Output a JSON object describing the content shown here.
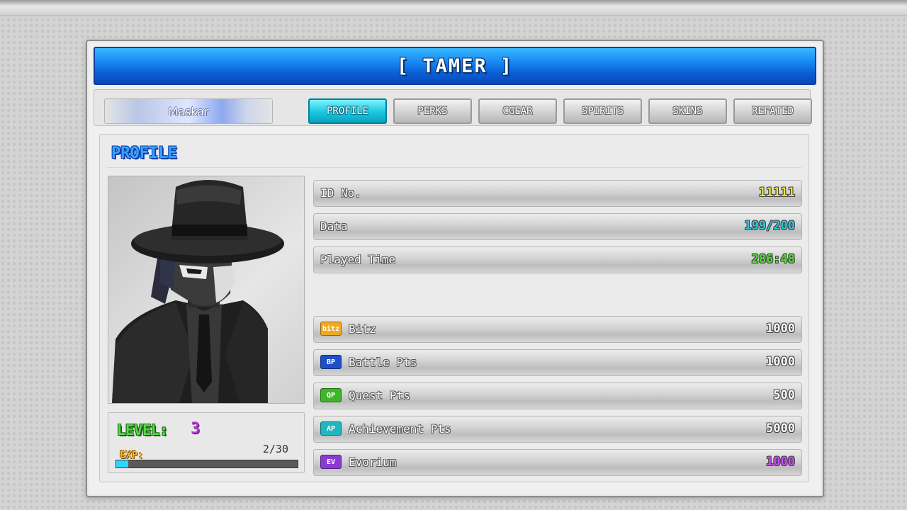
{
  "window": {
    "title": "[ TAMER ]"
  },
  "player": {
    "name": "Maskar"
  },
  "tabs": [
    {
      "label": "PROFILE",
      "active": true
    },
    {
      "label": "PERKS",
      "active": false
    },
    {
      "label": "CGEAR",
      "active": false
    },
    {
      "label": "SPIRITS",
      "active": false
    },
    {
      "label": "SKINS",
      "active": false
    },
    {
      "label": "REFATED",
      "active": false
    }
  ],
  "profile": {
    "section_title": "PROFILE",
    "level_label": "LEVEL:",
    "level": "3",
    "exp_label": "EXP:",
    "exp_text": "2/30",
    "exp_fraction": 0.067,
    "info": [
      {
        "label": "ID No.",
        "value": "11111",
        "color": "#e8e23a"
      },
      {
        "label": "Data",
        "value": "199/200",
        "color": "#2fc6d8"
      },
      {
        "label": "Played Time",
        "value": "286:48",
        "color": "#55d83a"
      }
    ],
    "currencies": [
      {
        "badge": "bitz",
        "label": "Bitz",
        "value": "1000",
        "badge_color": "#f0a820",
        "value_color": "#ffffff",
        "icon": "bitz-badge-icon"
      },
      {
        "badge": "BP",
        "label": "Battle Pts",
        "value": "1000",
        "badge_color": "#1f4fc8",
        "value_color": "#ffffff",
        "icon": "bp-badge-icon"
      },
      {
        "badge": "QP",
        "label": "Quest Pts",
        "value": "500",
        "badge_color": "#3fb52a",
        "value_color": "#ffffff",
        "icon": "qp-badge-icon"
      },
      {
        "badge": "AP",
        "label": "Achievement Pts",
        "value": "5000",
        "badge_color": "#1fb6bd",
        "value_color": "#ffffff",
        "icon": "ap-badge-icon"
      },
      {
        "badge": "EV",
        "label": "Evorium",
        "value": "1000",
        "badge_color": "#8a3ad0",
        "value_color": "#c84bf2",
        "icon": "ev-badge-icon"
      }
    ]
  }
}
